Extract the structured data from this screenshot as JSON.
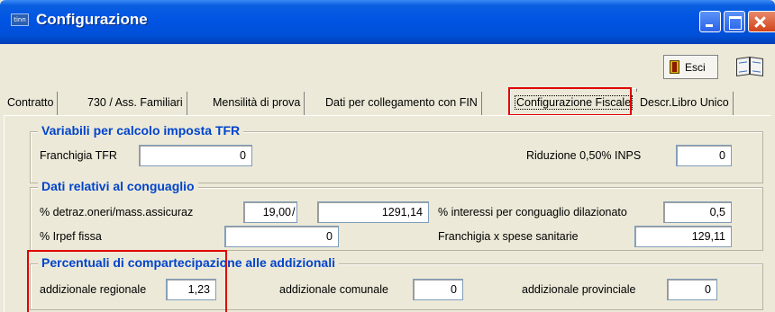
{
  "window": {
    "title": "Configurazione",
    "logo_text": "tinn"
  },
  "toolbar": {
    "esci_label": "Esci"
  },
  "tabs": [
    {
      "label": "Contratto"
    },
    {
      "label": "730 / Ass. Familiari"
    },
    {
      "label": "Mensilità di prova"
    },
    {
      "label": "Dati per collegamento con FIN"
    },
    {
      "label": "Configurazione Fiscale",
      "active": true
    },
    {
      "label": "Descr.Libro Unico"
    }
  ],
  "groups": {
    "tfr": {
      "title": "Variabili per calcolo imposta TFR",
      "franchigia_label": "Franchigia TFR",
      "franchigia_value": "0",
      "riduzione_label": "Riduzione 0,50% INPS",
      "riduzione_value": "0"
    },
    "conguaglio": {
      "title": "Dati relativi al conguaglio",
      "detraz_label": "% detraz.oneri/mass.assicuraz",
      "detraz_value": "19,00",
      "separator": "/",
      "massimale_value": "1291,14",
      "interessi_label": "% interessi per conguaglio dilazionato",
      "interessi_value": "0,5",
      "irpef_label": "% Irpef fissa",
      "irpef_value": "0",
      "franchigia_sanitarie_label": "Franchigia x spese sanitarie",
      "franchigia_sanitarie_value": "129,11"
    },
    "addizionali": {
      "title": "Percentuali di compartecipazione alle addizionali",
      "regionale_label": "addizionale regionale",
      "regionale_value": "1,23",
      "comunale_label": "addizionale comunale",
      "comunale_value": "0",
      "provinciale_label": "addizionale provinciale",
      "provinciale_value": "0"
    }
  },
  "colors": {
    "titlebar": "#0054e3",
    "group_title": "#0044cc",
    "highlight": "#e00000"
  }
}
